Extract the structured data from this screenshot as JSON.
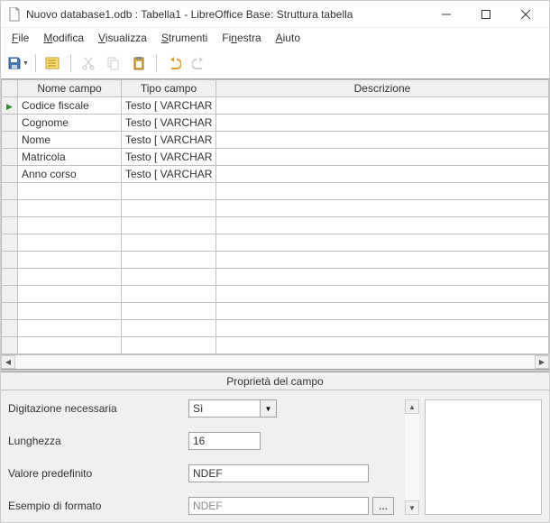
{
  "window": {
    "title": "Nuovo database1.odb : Tabella1 - LibreOffice Base: Struttura tabella"
  },
  "menubar": {
    "items": [
      {
        "accel": "F",
        "rest": "ile"
      },
      {
        "accel": "M",
        "rest": "odifica"
      },
      {
        "accel": "V",
        "rest": "isualizza"
      },
      {
        "accel": "S",
        "rest": "trumenti"
      },
      {
        "accel": "",
        "rest": "Fi",
        "accel2": "n",
        "rest2": "estra"
      },
      {
        "accel": "A",
        "rest": "iuto"
      }
    ]
  },
  "table": {
    "headers": {
      "name": "Nome campo",
      "type": "Tipo campo",
      "desc": "Descrizione"
    },
    "rows": [
      {
        "indicator": "▶",
        "name": "Codice fiscale",
        "type": "Testo [ VARCHAR ]",
        "desc": ""
      },
      {
        "indicator": "",
        "name": "Cognome",
        "type": "Testo [ VARCHAR ]",
        "desc": ""
      },
      {
        "indicator": "",
        "name": "Nome",
        "type": "Testo [ VARCHAR ]",
        "desc": ""
      },
      {
        "indicator": "",
        "name": "Matricola",
        "type": "Testo [ VARCHAR ]",
        "desc": ""
      },
      {
        "indicator": "",
        "name": "Anno corso",
        "type": "Testo [ VARCHAR ]",
        "desc": ""
      }
    ]
  },
  "properties": {
    "title": "Proprietà del campo",
    "entry_required_label": "Digitazione necessaria",
    "entry_required_value": "Sì",
    "length_label": "Lunghezza",
    "length_value": "16",
    "default_label": "Valore predefinito",
    "default_value": "NDEF",
    "format_label": "Esempio di formato",
    "format_value": "NDEF",
    "dots": "..."
  }
}
